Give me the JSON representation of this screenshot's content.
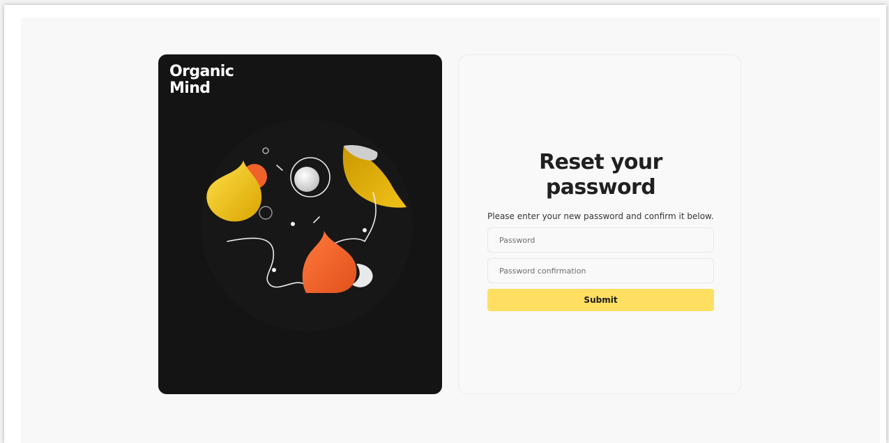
{
  "brand": {
    "line1": "Organic",
    "line2": "Mind"
  },
  "form": {
    "title": "Reset your password",
    "subtitle": "Please enter your new password and confirm it below.",
    "password_placeholder": "Password",
    "password_confirmation_placeholder": "Password confirmation",
    "submit_label": "Submit"
  },
  "colors": {
    "accent": "#fedf62",
    "card_dark": "#141414",
    "orange": "#f0622a",
    "yellow": "#f5c51a"
  }
}
